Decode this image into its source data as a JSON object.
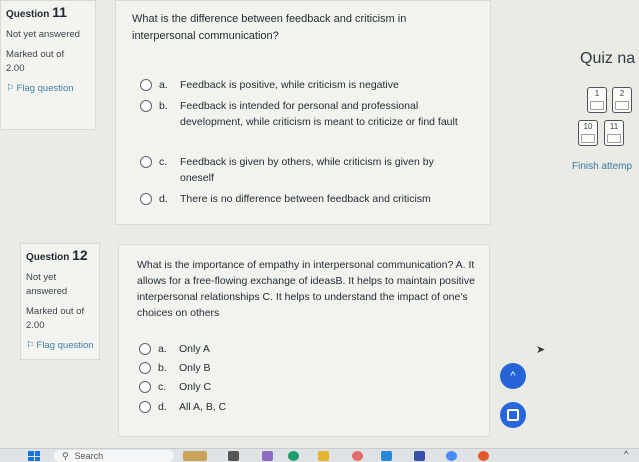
{
  "question11": {
    "heading": "Question",
    "number": "11",
    "status": "Not yet answered",
    "marked_label": "Marked out of",
    "marked_value": "2.00",
    "flag_label": "Flag question",
    "prompt": "What is the difference between feedback and criticism in interpersonal communication?",
    "options": [
      {
        "letter": "a.",
        "text": "Feedback is positive, while criticism is negative"
      },
      {
        "letter": "b.",
        "text": "Feedback is intended for personal and professional development, while criticism is meant to criticize or find fault"
      },
      {
        "letter": "c.",
        "text": "Feedback is given by others, while criticism is given by oneself"
      },
      {
        "letter": "d.",
        "text": "There is no difference between feedback and criticism"
      }
    ]
  },
  "question12": {
    "heading": "Question",
    "number": "12",
    "status": "Not yet answered",
    "marked_label": "Marked out of",
    "marked_value": "2.00",
    "flag_label": "Flag question",
    "prompt": "What is the importance of empathy in interpersonal communication? A. It allows for a free-flowing exchange of ideasB. It helps to maintain positive interpersonal relationships C. It helps to understand the impact of one's choices on others",
    "options": [
      {
        "letter": "a.",
        "text": "Only A"
      },
      {
        "letter": "b.",
        "text": "Only B"
      },
      {
        "letter": "c.",
        "text": "Only C"
      },
      {
        "letter": "d.",
        "text": "All A, B, C"
      }
    ]
  },
  "quiz_nav": {
    "title": "Quiz na",
    "buttons": [
      "1",
      "2",
      "10",
      "11"
    ],
    "finish_label": "Finish attemp"
  },
  "taskbar": {
    "search_label": "Search"
  }
}
